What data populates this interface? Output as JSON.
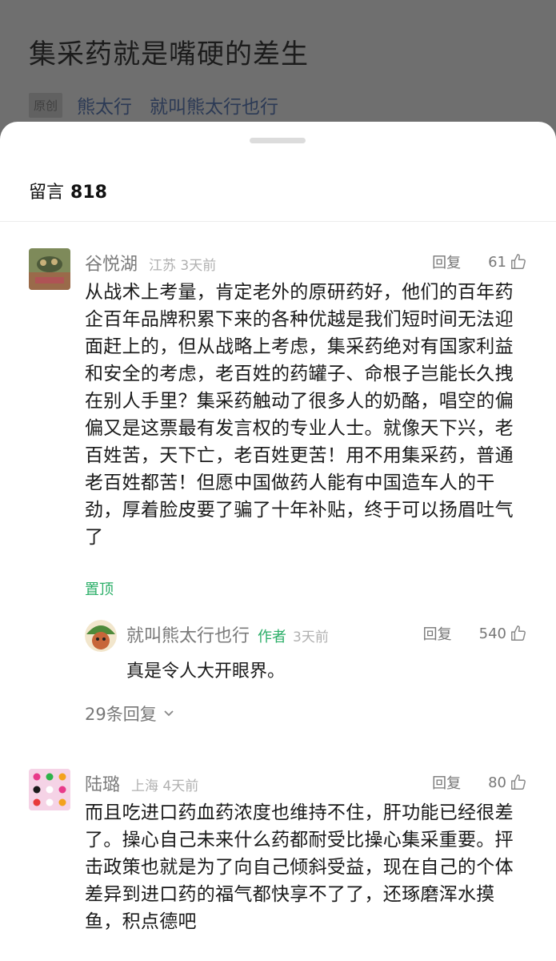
{
  "article": {
    "title": "集采药就是嘴硬的差生",
    "badge": "原创",
    "author": "熊太行",
    "account": "就叫熊太行也行"
  },
  "comments_sheet": {
    "label": "留言",
    "count": "818"
  },
  "comments": [
    {
      "name": "谷悦湖",
      "meta": "江苏 3天前",
      "reply_label": "回复",
      "likes": "61",
      "text": "从战术上考量，肯定老外的原研药好，他们的百年药企百年品牌积累下来的各种优越是我们短时间无法迎面赶上的，但从战略上考虑，集采药绝对有国家利益和安全的考虑，老百姓的药罐子、命根子岂能长久拽在别人手里？集采药触动了很多人的奶酪，唱空的偏偏又是这票最有发言权的专业人士。就像天下兴，老百姓苦，天下亡，老百姓更苦！用不用集采药，普通老百姓都苦！但愿中国做药人能有中国造车人的干劲，厚着脸皮要了骗了十年补贴，终于可以扬眉吐气了",
      "pinned": "置顶",
      "reply": {
        "name": "就叫熊太行也行",
        "tag": "作者",
        "time": "3天前",
        "reply_label": "回复",
        "likes": "540",
        "text": "真是令人大开眼界。"
      },
      "more_replies": "29条回复"
    },
    {
      "name": "陆璐",
      "meta": "上海 4天前",
      "reply_label": "回复",
      "likes": "80",
      "text": "而且吃进口药血药浓度也维持不住，肝功能已经很差了。操心自己未来什么药都耐受比操心集采重要。抨击政策也就是为了向自己倾斜受益，现在自己的个体差异到进口药的福气都快享不了了，还琢磨浑水摸鱼，积点德吧"
    }
  ],
  "colors": {
    "accent_green": "#2aae67",
    "overlay": "#7a7a7a"
  }
}
